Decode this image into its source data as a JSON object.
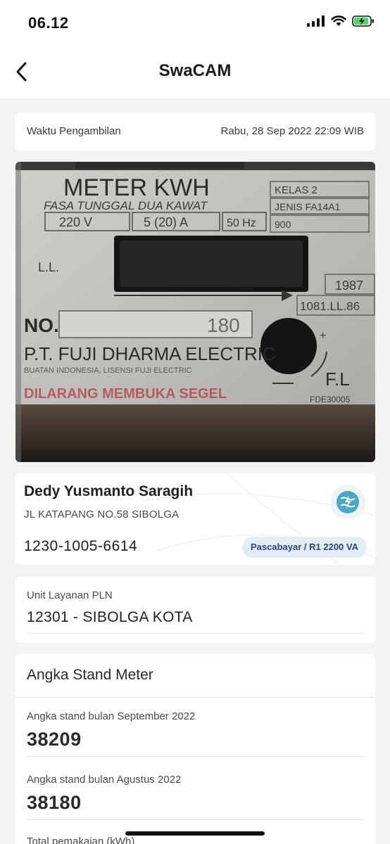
{
  "status_bar": {
    "time": "06.12"
  },
  "header": {
    "title": "SwaCAM"
  },
  "capture": {
    "label": "Waktu Pengambilan",
    "value": "Rabu, 28 Sep 2022 22:09 WIB"
  },
  "photo": {
    "meter_title": "METER KWH",
    "line1": "FASA TUNGGAL DUA KAWAT",
    "voltage": "220 V",
    "current": "5 (20) A",
    "frequency": "50 Hz",
    "kelas": "KELAS 2",
    "jenis": "JENIS FA14A1",
    "rev": "900",
    "year": "1987",
    "serial": "1081.LL.86",
    "no": "NO.",
    "no_value": "180",
    "maker": "P.T. FUJI DHARMA ELECTRIC",
    "made_in": "BUATAN INDONESIA, LISENSI FUJI ELECTRIC",
    "seal": "DILARANG MEMBUKA SEGEL",
    "fl": "F.L",
    "code": "FDE30005",
    "ll": "L.L."
  },
  "customer": {
    "name": "Dedy Yusmanto Saragih",
    "address": "JL KATAPANG NO.58 SIBOLGA",
    "id": "1230-1005-6614",
    "tariff": "Pascabayar / R1 2200 VA",
    "logo_icon": "pln-logo-icon"
  },
  "unit": {
    "label": "Unit Layanan PLN",
    "value": "12301 - SIBOLGA KOTA"
  },
  "meter": {
    "title": "Angka Stand Meter",
    "readings": [
      {
        "label": "Angka stand bulan September 2022",
        "value": "38209"
      },
      {
        "label": "Angka stand bulan Agustus 2022",
        "value": "38180"
      }
    ],
    "total_label": "Total pemakaian (kWh)"
  },
  "colors": {
    "accent": "#4aa9c2",
    "badge_bg": "#e4ecf6",
    "badge_text": "#28467a"
  }
}
